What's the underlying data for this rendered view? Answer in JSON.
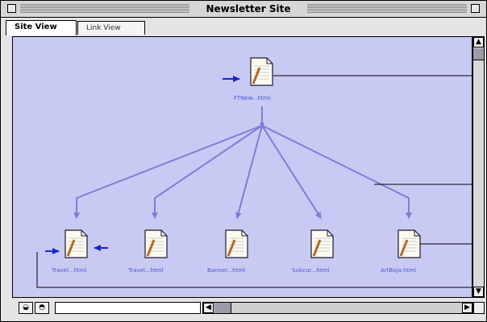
{
  "window": {
    "title": "Newsletter Site"
  },
  "tabs": [
    {
      "label": "Site View",
      "active": true
    },
    {
      "label": "Link View",
      "active": false
    }
  ],
  "site_map": {
    "root": {
      "label": "FTNew...html"
    },
    "children": [
      {
        "label": "Travel...html"
      },
      {
        "label": "Travel...html"
      },
      {
        "label": "Banner...html"
      },
      {
        "label": "Subcur...html"
      },
      {
        "label": "ArtBoja.html"
      }
    ]
  },
  "colors": {
    "canvas": "#c9caf4",
    "links": "#7a7ed6",
    "arrows": "#1b27c8",
    "label": "#4a56c8"
  },
  "icons": {
    "close": "close-box-icon",
    "zoom": "zoom-box-icon",
    "file": "html-file-icon",
    "scroll_up": "scroll-up-arrow-icon",
    "scroll_down": "scroll-down-arrow-icon",
    "scroll_left": "scroll-left-arrow-icon",
    "scroll_right": "scroll-right-arrow-icon",
    "grow": "grow-box-icon"
  }
}
